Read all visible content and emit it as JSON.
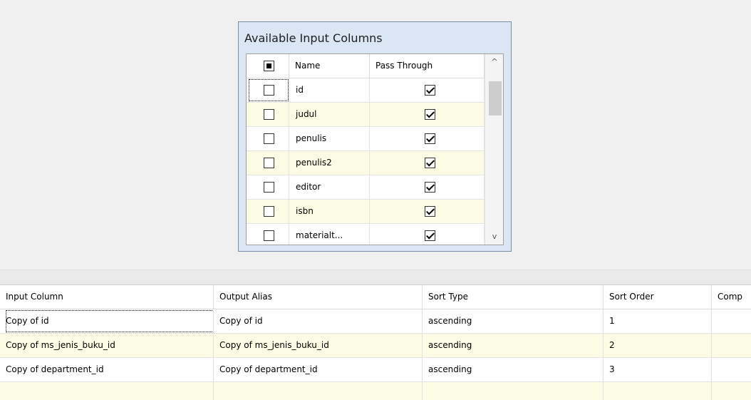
{
  "panel": {
    "title": "Available Input Columns",
    "header": {
      "name": "Name",
      "pass_through": "Pass Through"
    },
    "rows": [
      {
        "name": "id",
        "selected": false,
        "pass_through": true
      },
      {
        "name": "judul",
        "selected": false,
        "pass_through": true
      },
      {
        "name": "penulis",
        "selected": false,
        "pass_through": true
      },
      {
        "name": "penulis2",
        "selected": false,
        "pass_through": true
      },
      {
        "name": "editor",
        "selected": false,
        "pass_through": true
      },
      {
        "name": "isbn",
        "selected": false,
        "pass_through": true
      },
      {
        "name": "materialt...",
        "selected": false,
        "pass_through": true
      }
    ],
    "scroll": {
      "up": "^",
      "down": "v"
    }
  },
  "output": {
    "headers": [
      "Input Column",
      "Output Alias",
      "Sort Type",
      "Sort Order",
      "Comp"
    ],
    "rows": [
      [
        "Copy of id",
        "Copy of id",
        "ascending",
        "1",
        ""
      ],
      [
        "Copy of ms_jenis_buku_id",
        "Copy of ms_jenis_buku_id",
        "ascending",
        "2",
        ""
      ],
      [
        "Copy of department_id",
        "Copy of department_id",
        "ascending",
        "3",
        ""
      ],
      [
        "",
        "",
        "",
        "",
        ""
      ]
    ]
  },
  "colors": {
    "panel_bg": "#dbe6f4",
    "alt_row": "#fcfce4",
    "window_bg": "#f0f0f0"
  }
}
